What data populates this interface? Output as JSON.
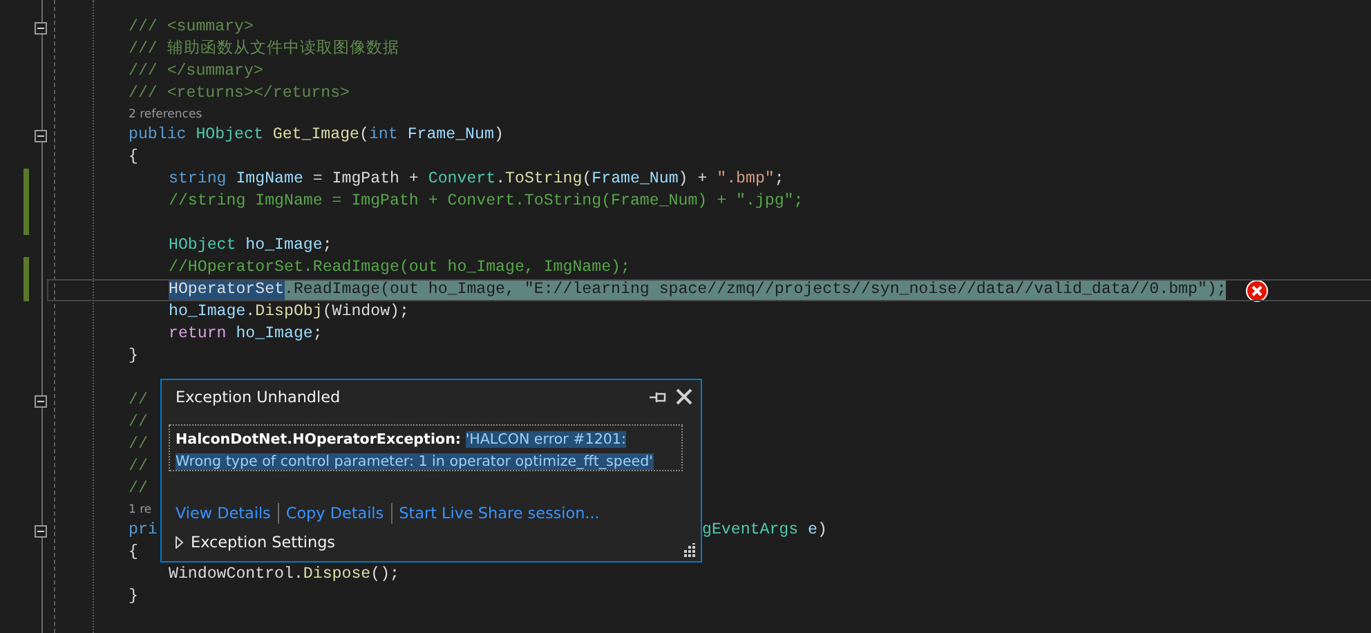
{
  "editor": {
    "lines": [
      {
        "kind": "code",
        "expanded": true,
        "tokens": [
          {
            "text": "/// <summary>",
            "kind": "doc"
          }
        ]
      },
      {
        "kind": "code",
        "tokens": [
          {
            "text": "/// 辅助函数从文件中读取图像数据",
            "kind": "doc"
          }
        ]
      },
      {
        "kind": "code",
        "tokens": [
          {
            "text": "/// </summary>",
            "kind": "doc"
          }
        ]
      },
      {
        "kind": "code",
        "tokens": [
          {
            "text": "/// <returns></returns>",
            "kind": "doc"
          }
        ]
      },
      {
        "kind": "codelens",
        "text": "2 references"
      },
      {
        "kind": "code",
        "expanded": true,
        "tokens": [
          {
            "text": "public ",
            "kind": "keyword"
          },
          {
            "text": "HObject ",
            "kind": "type"
          },
          {
            "text": "Get_Image",
            "kind": "method"
          },
          {
            "text": "(",
            "kind": "plain"
          },
          {
            "text": "int ",
            "kind": "keyword"
          },
          {
            "text": "Frame_Num",
            "kind": "variable"
          },
          {
            "text": ")",
            "kind": "plain"
          }
        ]
      },
      {
        "kind": "code",
        "tokens": [
          {
            "text": "{",
            "kind": "plain"
          }
        ],
        "children": [
          {
            "kind": "code",
            "changed": true,
            "tokens": [
              {
                "text": "string ",
                "kind": "keyword"
              },
              {
                "text": "ImgName",
                "kind": "variable"
              },
              {
                "text": " = ImgPath + ",
                "kind": "plain"
              },
              {
                "text": "Convert",
                "kind": "type"
              },
              {
                "text": ".",
                "kind": "plain"
              },
              {
                "text": "ToString",
                "kind": "method"
              },
              {
                "text": "(",
                "kind": "plain"
              },
              {
                "text": "Frame_Num",
                "kind": "variable"
              },
              {
                "text": ") + ",
                "kind": "plain"
              },
              {
                "text": "\".bmp\"",
                "kind": "string"
              },
              {
                "text": ";",
                "kind": "plain"
              }
            ]
          },
          {
            "kind": "code",
            "changed": true,
            "tokens": [
              {
                "text": "//string ImgName = ImgPath + Convert.ToString(Frame_Num) + \".jpg\";",
                "kind": "comment"
              }
            ]
          },
          {
            "kind": "blank",
            "changed": true
          },
          {
            "kind": "code",
            "tokens": [
              {
                "text": "HObject ",
                "kind": "type"
              },
              {
                "text": "ho_Image",
                "kind": "variable"
              },
              {
                "text": ";",
                "kind": "plain"
              }
            ]
          },
          {
            "kind": "code",
            "changed": true,
            "tokens": [
              {
                "text": "//HOperatorSet.ReadImage(out ho_Image, ImgName);",
                "kind": "comment"
              }
            ]
          },
          {
            "kind": "code",
            "changed": true,
            "current": true,
            "error": true,
            "tokens": [
              {
                "text": "HOperatorSet",
                "kind": "selected"
              },
              {
                "text": ".ReadImage(out ho_Image, \"E://learning space//zmq//projects//syn_noise//data//valid_data//0.bmp\");",
                "kind": "statement"
              }
            ]
          },
          {
            "kind": "code",
            "tokens": [
              {
                "text": "ho_Image",
                "kind": "variable"
              },
              {
                "text": ".",
                "kind": "plain"
              },
              {
                "text": "DispObj",
                "kind": "method"
              },
              {
                "text": "(Window);",
                "kind": "plain"
              }
            ]
          },
          {
            "kind": "code",
            "tokens": [
              {
                "text": "return ",
                "kind": "control"
              },
              {
                "text": "ho_Image",
                "kind": "variable"
              },
              {
                "text": ";",
                "kind": "plain"
              }
            ]
          }
        ]
      },
      {
        "kind": "code",
        "tokens": [
          {
            "text": "}",
            "kind": "plain"
          }
        ]
      },
      {
        "kind": "blank"
      },
      {
        "kind": "code",
        "expanded": true,
        "tokens": [
          {
            "text": "//",
            "kind": "doc"
          }
        ]
      },
      {
        "kind": "code",
        "tokens": [
          {
            "text": "//",
            "kind": "doc"
          }
        ]
      },
      {
        "kind": "code",
        "tokens": [
          {
            "text": "//",
            "kind": "doc"
          }
        ]
      },
      {
        "kind": "code",
        "tokens": [
          {
            "text": "//",
            "kind": "doc"
          }
        ]
      },
      {
        "kind": "code",
        "tokens": [
          {
            "text": "//",
            "kind": "doc"
          }
        ]
      },
      {
        "kind": "codelens",
        "text": "1 re"
      },
      {
        "kind": "code",
        "expanded": true,
        "tokens": [
          {
            "text": "pri",
            "kind": "keyword"
          }
        ],
        "right_tokens": [
          {
            "text": "gEventArgs ",
            "kind": "type"
          },
          {
            "text": "e",
            "kind": "variable"
          },
          {
            "text": ")",
            "kind": "plain"
          }
        ]
      },
      {
        "kind": "code",
        "tokens": [
          {
            "text": "{",
            "kind": "plain"
          }
        ],
        "children": [
          {
            "kind": "code",
            "tokens": [
              {
                "text": "WindowControl",
                "kind": "plain"
              },
              {
                "text": ".",
                "kind": "plain"
              },
              {
                "text": "Dispose",
                "kind": "method"
              },
              {
                "text": "();",
                "kind": "plain"
              }
            ]
          }
        ]
      },
      {
        "kind": "code",
        "tokens": [
          {
            "text": "}",
            "kind": "plain"
          }
        ]
      }
    ]
  },
  "exception_popup": {
    "title": "Exception Unhandled",
    "exception_type": "HalconDotNet.HOperatorException:",
    "message": "'HALCON error #1201: Wrong type of control parameter: 1 in operator optimize_fft_speed'",
    "links": [
      "View Details",
      "Copy Details",
      "Start Live Share session..."
    ],
    "settings": {
      "label": "Exception Settings",
      "expanded": false
    }
  }
}
